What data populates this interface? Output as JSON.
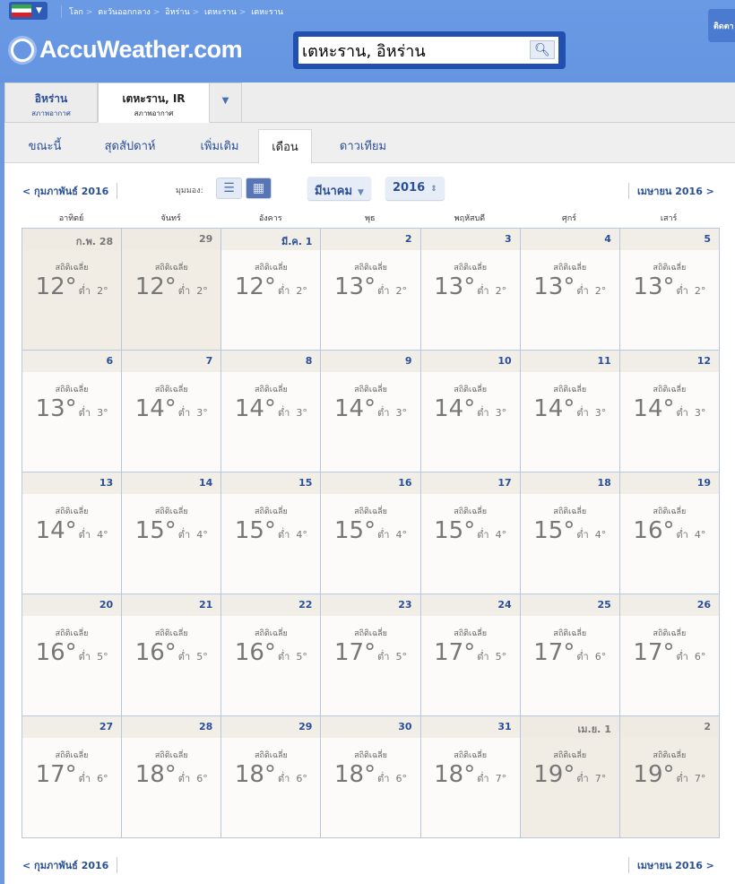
{
  "header": {
    "breadcrumbs": [
      "โลก",
      "ตะวันออกกลาง",
      "อิหร่าน",
      "เตหะราน",
      "เตหะราน"
    ],
    "logo": "AccuWeather.com",
    "search_value": "เตหะราน, อิหร่าน",
    "follow_label": "ติดตา"
  },
  "location_tabs": [
    {
      "title": "อิหร่าน",
      "sub": "สภาพอากาศ"
    },
    {
      "title": "เตหะราน, IR",
      "sub": "สภาพอากาศ"
    }
  ],
  "nav_tabs": [
    "ขณะนี้",
    "สุดสัปดาห์",
    "เพิ่มเติม",
    "เดือน",
    "ดาวเทียม"
  ],
  "active_nav": "เดือน",
  "controls": {
    "prev": "< กุมภาพันธ์ 2016",
    "next": "เมษายน 2016 >",
    "view_label": "มุมมอง:",
    "month": "มีนาคม",
    "year": "2016"
  },
  "weekdays": [
    "อาทิตย์",
    "จันทร์",
    "อังคาร",
    "พุธ",
    "พฤหัสบดี",
    "ศุกร์",
    "เสาร์"
  ],
  "avg_label": "สถิติเฉลี่ย",
  "low_label": "ต่ำ",
  "days": [
    {
      "d": "ก.พ. 28",
      "hi": "12°",
      "lo": "2°",
      "out": true
    },
    {
      "d": "29",
      "hi": "12°",
      "lo": "2°",
      "out": true
    },
    {
      "d": "มี.ค. 1",
      "hi": "12°",
      "lo": "2°"
    },
    {
      "d": "2",
      "hi": "13°",
      "lo": "2°"
    },
    {
      "d": "3",
      "hi": "13°",
      "lo": "2°"
    },
    {
      "d": "4",
      "hi": "13°",
      "lo": "2°"
    },
    {
      "d": "5",
      "hi": "13°",
      "lo": "2°"
    },
    {
      "d": "6",
      "hi": "13°",
      "lo": "3°"
    },
    {
      "d": "7",
      "hi": "14°",
      "lo": "3°"
    },
    {
      "d": "8",
      "hi": "14°",
      "lo": "3°"
    },
    {
      "d": "9",
      "hi": "14°",
      "lo": "3°"
    },
    {
      "d": "10",
      "hi": "14°",
      "lo": "3°"
    },
    {
      "d": "11",
      "hi": "14°",
      "lo": "3°"
    },
    {
      "d": "12",
      "hi": "14°",
      "lo": "3°"
    },
    {
      "d": "13",
      "hi": "14°",
      "lo": "4°"
    },
    {
      "d": "14",
      "hi": "15°",
      "lo": "4°"
    },
    {
      "d": "15",
      "hi": "15°",
      "lo": "4°"
    },
    {
      "d": "16",
      "hi": "15°",
      "lo": "4°"
    },
    {
      "d": "17",
      "hi": "15°",
      "lo": "4°"
    },
    {
      "d": "18",
      "hi": "15°",
      "lo": "4°"
    },
    {
      "d": "19",
      "hi": "16°",
      "lo": "4°"
    },
    {
      "d": "20",
      "hi": "16°",
      "lo": "5°"
    },
    {
      "d": "21",
      "hi": "16°",
      "lo": "5°"
    },
    {
      "d": "22",
      "hi": "16°",
      "lo": "5°"
    },
    {
      "d": "23",
      "hi": "17°",
      "lo": "5°"
    },
    {
      "d": "24",
      "hi": "17°",
      "lo": "5°"
    },
    {
      "d": "25",
      "hi": "17°",
      "lo": "6°"
    },
    {
      "d": "26",
      "hi": "17°",
      "lo": "6°"
    },
    {
      "d": "27",
      "hi": "17°",
      "lo": "6°"
    },
    {
      "d": "28",
      "hi": "18°",
      "lo": "6°"
    },
    {
      "d": "29",
      "hi": "18°",
      "lo": "6°"
    },
    {
      "d": "30",
      "hi": "18°",
      "lo": "6°"
    },
    {
      "d": "31",
      "hi": "18°",
      "lo": "7°"
    },
    {
      "d": "เม.ย. 1",
      "hi": "19°",
      "lo": "7°",
      "out": true
    },
    {
      "d": "2",
      "hi": "19°",
      "lo": "7°",
      "out": true
    }
  ]
}
